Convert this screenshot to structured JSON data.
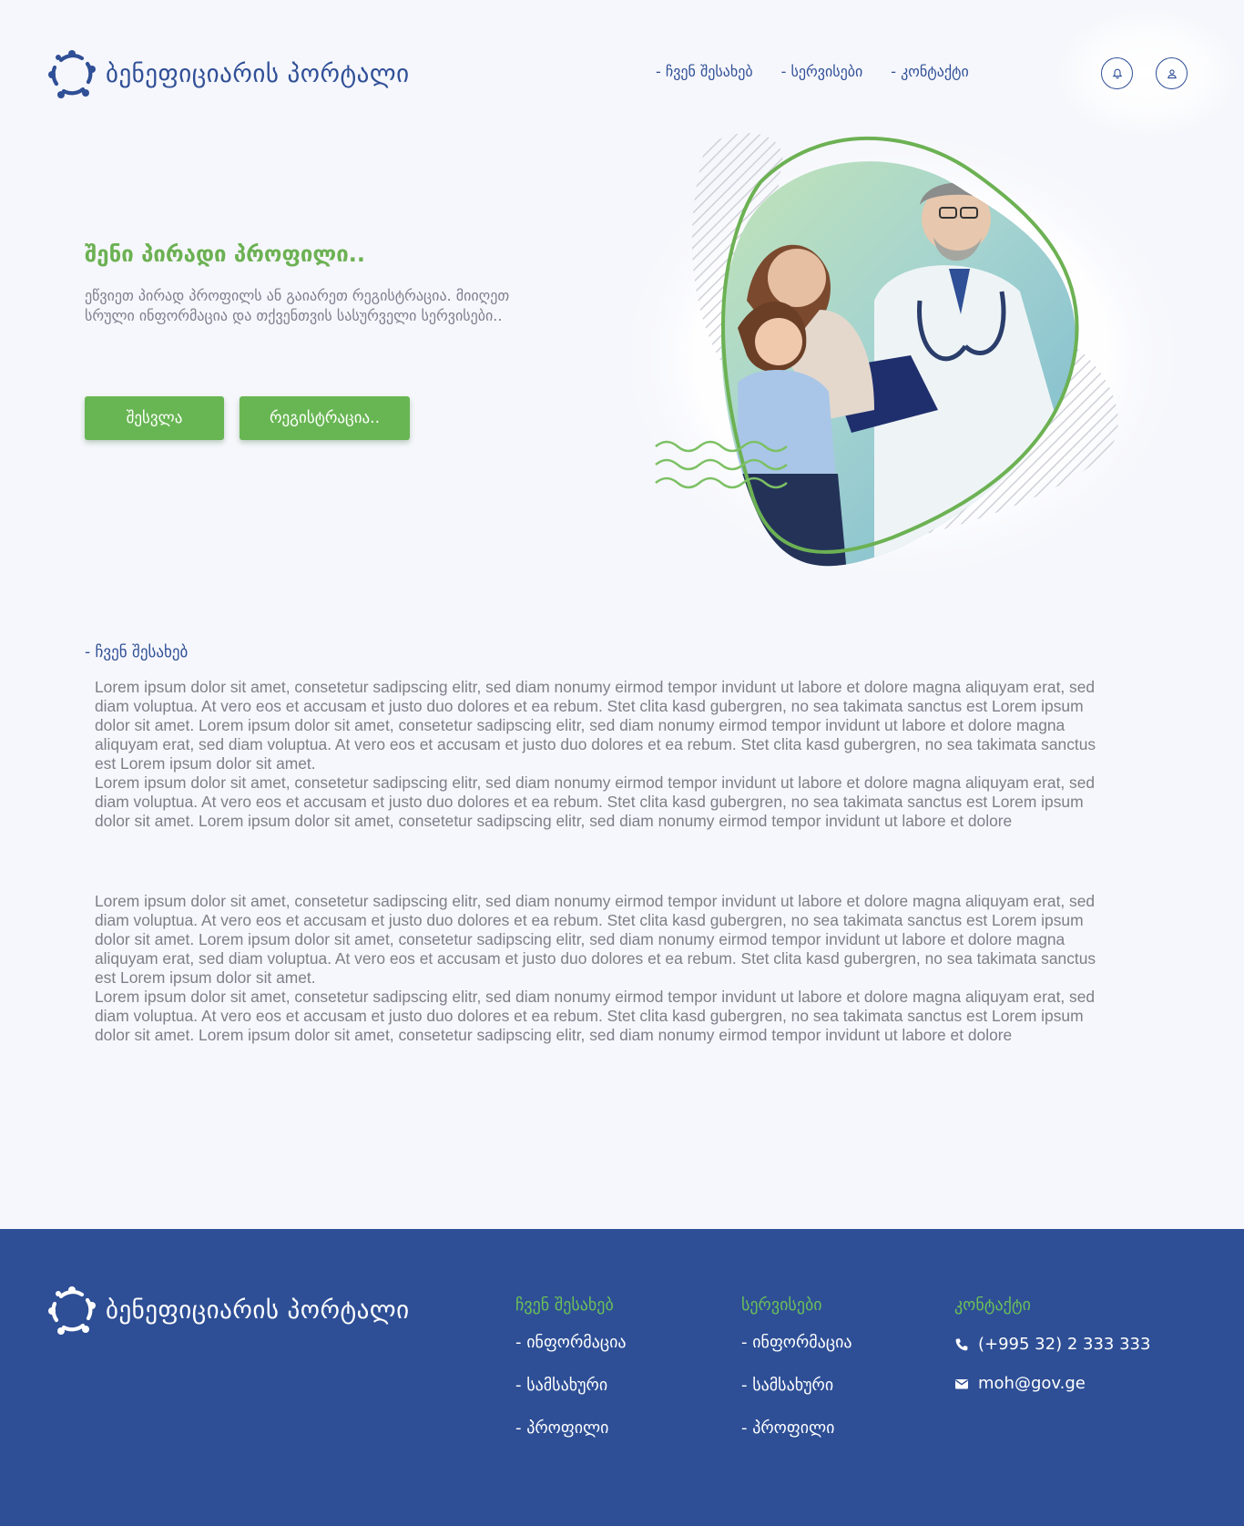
{
  "header": {
    "logo_text": "ბენეფიციარის პორტალი",
    "nav": [
      {
        "label": "- ჩვენ შესახებ"
      },
      {
        "label": "- სერვისები"
      },
      {
        "label": "- კონტაქტი"
      }
    ],
    "notification_icon": "bell-icon",
    "profile_icon": "user-icon"
  },
  "hero": {
    "title": "შენი პირადი პროფილი..",
    "description": "ეწვიეთ პირად პროფილს ან გაიარეთ რეგისტრაცია. მიიღეთ სრული ინფორმაცია და თქვენთვის სასურველი სერვისები..",
    "login_label": "შესვლა",
    "register_label": "რეგისტრაცია..",
    "accent_color": "#68b653"
  },
  "about": {
    "label": "- ჩვენ შესახებ",
    "paragraphs": [
      [
        "Lorem ipsum dolor sit amet, consetetur sadipscing elitr, sed diam nonumy eirmod tempor invidunt ut labore et dolore magna aliquyam erat, sed diam voluptua. At vero eos et accusam et justo duo dolores et ea rebum. Stet clita kasd gubergren, no sea takimata sanctus est Lorem ipsum dolor sit amet. Lorem ipsum dolor sit amet, consetetur sadipscing elitr, sed diam nonumy eirmod tempor invidunt ut labore et dolore magna aliquyam erat, sed diam voluptua. At vero eos et accusam et justo duo dolores et ea rebum. Stet clita kasd gubergren, no sea takimata sanctus est Lorem ipsum dolor sit amet.",
        "Lorem ipsum dolor sit amet, consetetur sadipscing elitr, sed diam nonumy eirmod tempor invidunt ut labore et dolore magna aliquyam erat, sed diam voluptua. At vero eos et accusam et justo duo dolores et ea rebum. Stet clita kasd gubergren, no sea takimata sanctus est Lorem ipsum dolor sit amet. Lorem ipsum dolor sit amet, consetetur sadipscing elitr, sed diam nonumy eirmod tempor invidunt ut labore et dolore"
      ],
      [
        "Lorem ipsum dolor sit amet, consetetur sadipscing elitr, sed diam nonumy eirmod tempor invidunt ut labore et dolore magna aliquyam erat, sed diam voluptua. At vero eos et accusam et justo duo dolores et ea rebum. Stet clita kasd gubergren, no sea takimata sanctus est Lorem ipsum dolor sit amet. Lorem ipsum dolor sit amet, consetetur sadipscing elitr, sed diam nonumy eirmod tempor invidunt ut labore et dolore magna aliquyam erat, sed diam voluptua. At vero eos et accusam et justo duo dolores et ea rebum. Stet clita kasd gubergren, no sea takimata sanctus est Lorem ipsum dolor sit amet.",
        "Lorem ipsum dolor sit amet, consetetur sadipscing elitr, sed diam nonumy eirmod tempor invidunt ut labore et dolore magna aliquyam erat, sed diam voluptua. At vero eos et accusam et justo duo dolores et ea rebum. Stet clita kasd gubergren, no sea takimata sanctus est Lorem ipsum dolor sit amet. Lorem ipsum dolor sit amet, consetetur sadipscing elitr, sed diam nonumy eirmod tempor invidunt ut labore et dolore"
      ]
    ]
  },
  "footer": {
    "logo_text": "ბენეფიციარის პორტალი",
    "background_color": "#2e4f96",
    "columns": [
      {
        "title": "ჩვენ შესახებ",
        "items": [
          "- ინფორმაცია",
          "- სამსახური",
          "- პროფილი"
        ]
      },
      {
        "title": "სერვისები",
        "items": [
          "- ინფორმაცია",
          "- სამსახური",
          "- პროფილი"
        ]
      }
    ],
    "contact": {
      "title": "კონტაქტი",
      "phone": "(+995 32) 2 333 333",
      "email": "moh@gov.ge",
      "phone_icon": "phone-icon",
      "email_icon": "mail-icon"
    }
  }
}
